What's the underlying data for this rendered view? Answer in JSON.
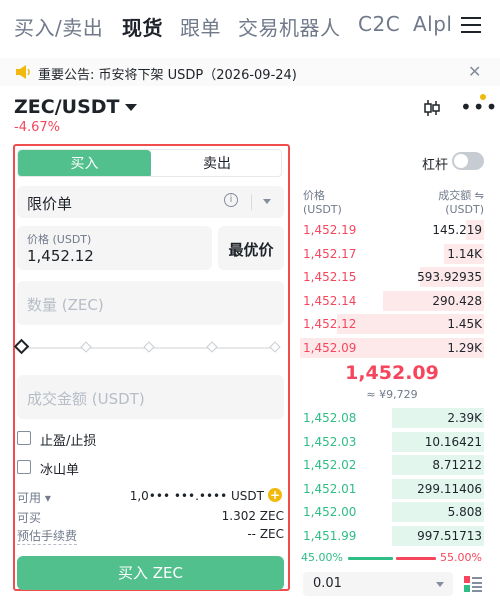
{
  "top_tabs": [
    "买入/卖出",
    "现货",
    "跟单",
    "交易机器人",
    "C2C",
    "Alpl"
  ],
  "active_tab": "现货",
  "announcement": {
    "text": "重要公告: 币安将下架 USDP（2026-09-24)"
  },
  "pair": {
    "symbol": "ZEC/USDT",
    "change": "-4.67%"
  },
  "order_form": {
    "buy_label": "买入",
    "sell_label": "卖出",
    "order_type": "限价单",
    "price_label": "价格 (USDT)",
    "price_value": "1,452.12",
    "best_price_label": "最优价",
    "quantity_placeholder": "数量 (ZEC)",
    "total_placeholder": "成交金额 (USDT)",
    "tp_sl_label": "止盈/止损",
    "iceberg_label": "冰山单",
    "available_label": "可用",
    "available_value": "1,0••• •••.•••• USDT",
    "can_buy_label": "可买",
    "can_buy_value": "1.302 ZEC",
    "fee_label": "预估手续费",
    "fee_value": "-- ZEC",
    "submit_label": "买入 ZEC"
  },
  "leverage_label": "杠杆",
  "orderbook": {
    "price_header": "价格",
    "price_unit": "(USDT)",
    "amount_header": "成交额 ⇋",
    "amount_unit": "(USDT)",
    "asks": [
      {
        "price": "1,452.19",
        "amount": "145.219",
        "depth": 0.1
      },
      {
        "price": "1,452.17",
        "amount": "1.14K",
        "depth": 0.22
      },
      {
        "price": "1,452.15",
        "amount": "593.92935",
        "depth": 0.35
      },
      {
        "price": "1,452.14",
        "amount": "290.428",
        "depth": 0.55
      },
      {
        "price": "1,452.12",
        "amount": "1.45K",
        "depth": 0.8
      },
      {
        "price": "1,452.09",
        "amount": "1.29K",
        "depth": 1.0
      }
    ],
    "mid_price": "1,452.09",
    "mid_cny": "≈ ¥9,729",
    "bids": [
      {
        "price": "1,452.08",
        "amount": "2.39K",
        "depth": 0.5
      },
      {
        "price": "1,452.03",
        "amount": "10.16421",
        "depth": 0.5
      },
      {
        "price": "1,452.02",
        "amount": "8.71212",
        "depth": 0.5
      },
      {
        "price": "1,452.01",
        "amount": "299.11406",
        "depth": 0.5
      },
      {
        "price": "1,452.00",
        "amount": "5.808",
        "depth": 0.5
      },
      {
        "price": "1,451.99",
        "amount": "997.51713",
        "depth": 0.5
      }
    ],
    "buy_ratio": "45.00%",
    "sell_ratio": "55.00%",
    "depth_step": "0.01"
  },
  "colors": {
    "buy": "#2ebd85",
    "sell": "#f6465d",
    "accent": "#f0b90b"
  }
}
